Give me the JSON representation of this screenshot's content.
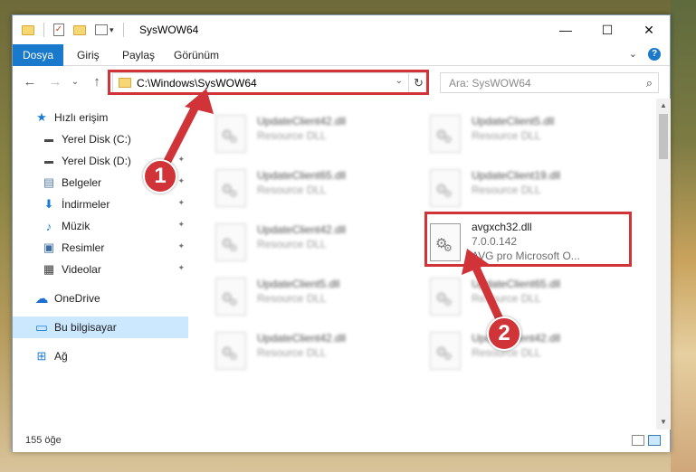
{
  "window": {
    "title": "SysWOW64",
    "minimize_glyph": "—",
    "maximize_glyph": "☐",
    "close_glyph": "✕"
  },
  "ribbon": {
    "tabs": [
      "Dosya",
      "Giriş",
      "Paylaş",
      "Görünüm"
    ],
    "expand_glyph": "⌄",
    "help_glyph": "?"
  },
  "navigation": {
    "back_glyph": "←",
    "forward_glyph": "→",
    "recent_glyph": "⌄",
    "up_glyph": "↑",
    "address": "C:\\Windows\\SysWOW64",
    "address_dropdown_glyph": "⌄",
    "refresh_glyph": "↻",
    "search_placeholder": "Ara: SysWOW64",
    "search_icon_glyph": "⌕"
  },
  "sidebar": {
    "items": [
      {
        "label": "Hızlı erişim",
        "icon": "star-icon",
        "glyph": "★",
        "color": "#1c7cd5",
        "pinned": false
      },
      {
        "label": "Yerel Disk (C:)",
        "icon": "drive-icon",
        "glyph": "▬",
        "color": "#4a4a4a",
        "pinned": true
      },
      {
        "label": "Yerel Disk (D:)",
        "icon": "drive-icon",
        "glyph": "▬",
        "color": "#4a4a4a",
        "pinned": true
      },
      {
        "label": "Belgeler",
        "icon": "document-icon",
        "glyph": "▤",
        "color": "#5a7fa6",
        "pinned": true
      },
      {
        "label": "İndirmeler",
        "icon": "download-icon",
        "glyph": "⬇",
        "color": "#1c7cd5",
        "pinned": true
      },
      {
        "label": "Müzik",
        "icon": "music-icon",
        "glyph": "♪",
        "color": "#1c7cd5",
        "pinned": true
      },
      {
        "label": "Resimler",
        "icon": "pictures-icon",
        "glyph": "▣",
        "color": "#3b6ea5",
        "pinned": true
      },
      {
        "label": "Videolar",
        "icon": "video-icon",
        "glyph": "▦",
        "color": "#3b3b3b",
        "pinned": true
      },
      {
        "label": "OneDrive",
        "icon": "cloud-icon",
        "glyph": "☁",
        "color": "#1c6fd0",
        "pinned": false
      },
      {
        "label": "Bu bilgisayar",
        "icon": "computer-icon",
        "glyph": "▭",
        "color": "#1c7cd5",
        "pinned": false
      },
      {
        "label": "Ağ",
        "icon": "network-icon",
        "glyph": "⊞",
        "color": "#1c7cd5",
        "pinned": false
      }
    ],
    "pin_glyph": "📌"
  },
  "files": {
    "left_column": [
      {
        "name": "UpdateClient42.dll",
        "type": "Resource DLL"
      },
      {
        "name": "UpdateClient65.dll",
        "type": "Resource DLL"
      },
      {
        "name": "UpdateClient42.dll",
        "type": "Resource DLL"
      },
      {
        "name": "UpdateClient5.dll",
        "type": "Resource DLL"
      },
      {
        "name": "UpdateClient42.dll",
        "type": "Resource DLL"
      }
    ],
    "right_column": [
      {
        "name": "UpdateClient5.dll",
        "type": "Resource DLL"
      },
      {
        "name": "UpdateClient19.dll",
        "type": "Resource DLL"
      },
      {
        "name": "UpdateClient65.dll",
        "type": "Resource DLL"
      },
      {
        "name": "UpdateClient42.dll",
        "type": "Resource DLL"
      }
    ],
    "highlighted": {
      "name": "avgxch32.dll",
      "version": "7.0.0.142",
      "description": "AVG pro Microsoft O..."
    }
  },
  "scrollbar": {
    "up_glyph": "▲",
    "down_glyph": "▼"
  },
  "status": {
    "item_count": "155 öğe"
  },
  "annotations": {
    "badge_1": "1",
    "badge_2": "2",
    "color": "#d13438"
  }
}
